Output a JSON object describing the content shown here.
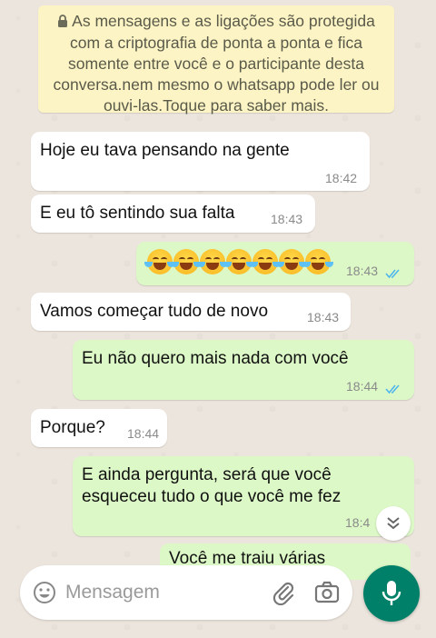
{
  "encryption_notice": "As mensagens e as ligações são protegida com a criptografia de ponta a ponta e fica somente entre você e o participante desta conversa.nem mesmo o whatsapp pode ler ou ouvi-las.Toque para saber mais.",
  "messages": [
    {
      "direction": "in",
      "text": "Hoje eu tava pensando na gente",
      "time": "18:42"
    },
    {
      "direction": "in",
      "text": "E eu tô sentindo sua falta",
      "time": "18:43"
    },
    {
      "direction": "out",
      "text": "😂😂😂😂😂😂😂",
      "time": "18:43",
      "status": "read"
    },
    {
      "direction": "in",
      "text": "Vamos começar tudo de novo",
      "time": "18:43"
    },
    {
      "direction": "out",
      "text": "Eu não quero mais nada com você",
      "time": "18:44",
      "status": "read"
    },
    {
      "direction": "in",
      "text": "Porque?",
      "time": "18:44"
    },
    {
      "direction": "out",
      "text_line1": "E ainda pergunta, será que você",
      "text_line2": "esqueceu tudo o que você me fez",
      "time": "18:4"
    },
    {
      "direction": "out",
      "text": "Você me traiu várias",
      "partial": true
    }
  ],
  "composer": {
    "placeholder": "Mensagem"
  },
  "icons": {
    "emoji": "emoji-icon",
    "attach": "paperclip-icon",
    "camera": "camera-icon",
    "mic": "mic-icon",
    "scroll": "chevron-double-down-icon",
    "lock": "lock-icon",
    "read": "double-check-icon"
  },
  "colors": {
    "outgoing": "#dcf8c6",
    "incoming": "#ffffff",
    "notice": "#fcf4c4",
    "accent": "#008069",
    "read_ticks": "#4fb6ec"
  }
}
